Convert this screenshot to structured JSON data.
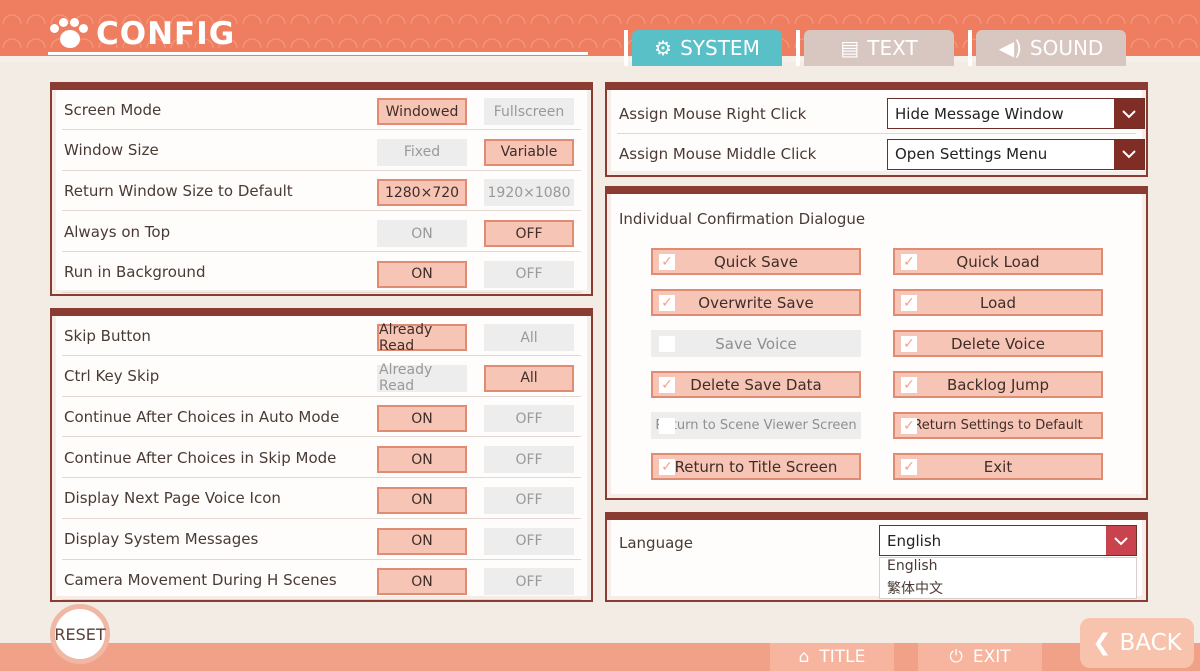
{
  "header": {
    "title": "CONFIG",
    "tabs": [
      {
        "label": "SYSTEM",
        "icon": "gear-icon"
      },
      {
        "label": "TEXT",
        "icon": "document-icon"
      },
      {
        "label": "SOUND",
        "icon": "speaker-icon"
      }
    ]
  },
  "display": {
    "rows": [
      {
        "label": "Screen Mode",
        "left": "Windowed",
        "right": "Fullscreen",
        "selected": "left"
      },
      {
        "label": "Window Size",
        "left": "Fixed",
        "right": "Variable",
        "selected": "right"
      },
      {
        "label": "Return Window Size to Default",
        "left": "1280×720",
        "right": "1920×1080",
        "selected": "left"
      },
      {
        "label": "Always on Top",
        "left": "ON",
        "right": "OFF",
        "selected": "right"
      },
      {
        "label": "Run in Background",
        "left": "ON",
        "right": "OFF",
        "selected": "left"
      }
    ]
  },
  "behavior": {
    "rows": [
      {
        "label": "Skip Button",
        "left": "Already Read",
        "right": "All",
        "selected": "left"
      },
      {
        "label": "Ctrl Key Skip",
        "left": "Already Read",
        "right": "All",
        "selected": "right"
      },
      {
        "label": "Continue After Choices  in Auto Mode",
        "left": "ON",
        "right": "OFF",
        "selected": "left"
      },
      {
        "label": "Continue After Choices  in Skip Mode",
        "left": "ON",
        "right": "OFF",
        "selected": "left"
      },
      {
        "label": "Display Next Page Voice Icon",
        "left": "ON",
        "right": "OFF",
        "selected": "left"
      },
      {
        "label": "Display System Messages",
        "left": "ON",
        "right": "OFF",
        "selected": "left"
      },
      {
        "label": "Camera Movement  During H Scenes",
        "left": "ON",
        "right": "OFF",
        "selected": "left"
      }
    ]
  },
  "mouse": {
    "rows": [
      {
        "label": "Assign Mouse Right Click",
        "value": "Hide Message Window"
      },
      {
        "label": "Assign Mouse Middle Click",
        "value": "Open Settings Menu"
      }
    ]
  },
  "dialogue": {
    "title": "Individual Confirmation Dialogue",
    "items": [
      {
        "label": "Quick Save",
        "checked": true
      },
      {
        "label": "Quick Load",
        "checked": true
      },
      {
        "label": "Overwrite Save",
        "checked": true
      },
      {
        "label": "Load",
        "checked": true
      },
      {
        "label": "Save Voice",
        "checked": false
      },
      {
        "label": "Delete Voice",
        "checked": true
      },
      {
        "label": "Delete Save Data",
        "checked": true
      },
      {
        "label": "Backlog Jump",
        "checked": true
      },
      {
        "label": "Return to Scene Viewer Screen",
        "checked": false
      },
      {
        "label": "Return Settings to Default",
        "checked": true
      },
      {
        "label": "Return to Title Screen",
        "checked": true
      },
      {
        "label": "Exit",
        "checked": true
      }
    ]
  },
  "language": {
    "label": "Language",
    "value": "English",
    "options": [
      "English",
      "繁体中文"
    ]
  },
  "footer": {
    "reset": "RESET",
    "title": "TITLE",
    "exit": "EXIT",
    "back": "BACK"
  },
  "colors": {
    "accent": "#ee7e5f",
    "active_tab": "#59c0c8",
    "border": "#8a3c32"
  }
}
